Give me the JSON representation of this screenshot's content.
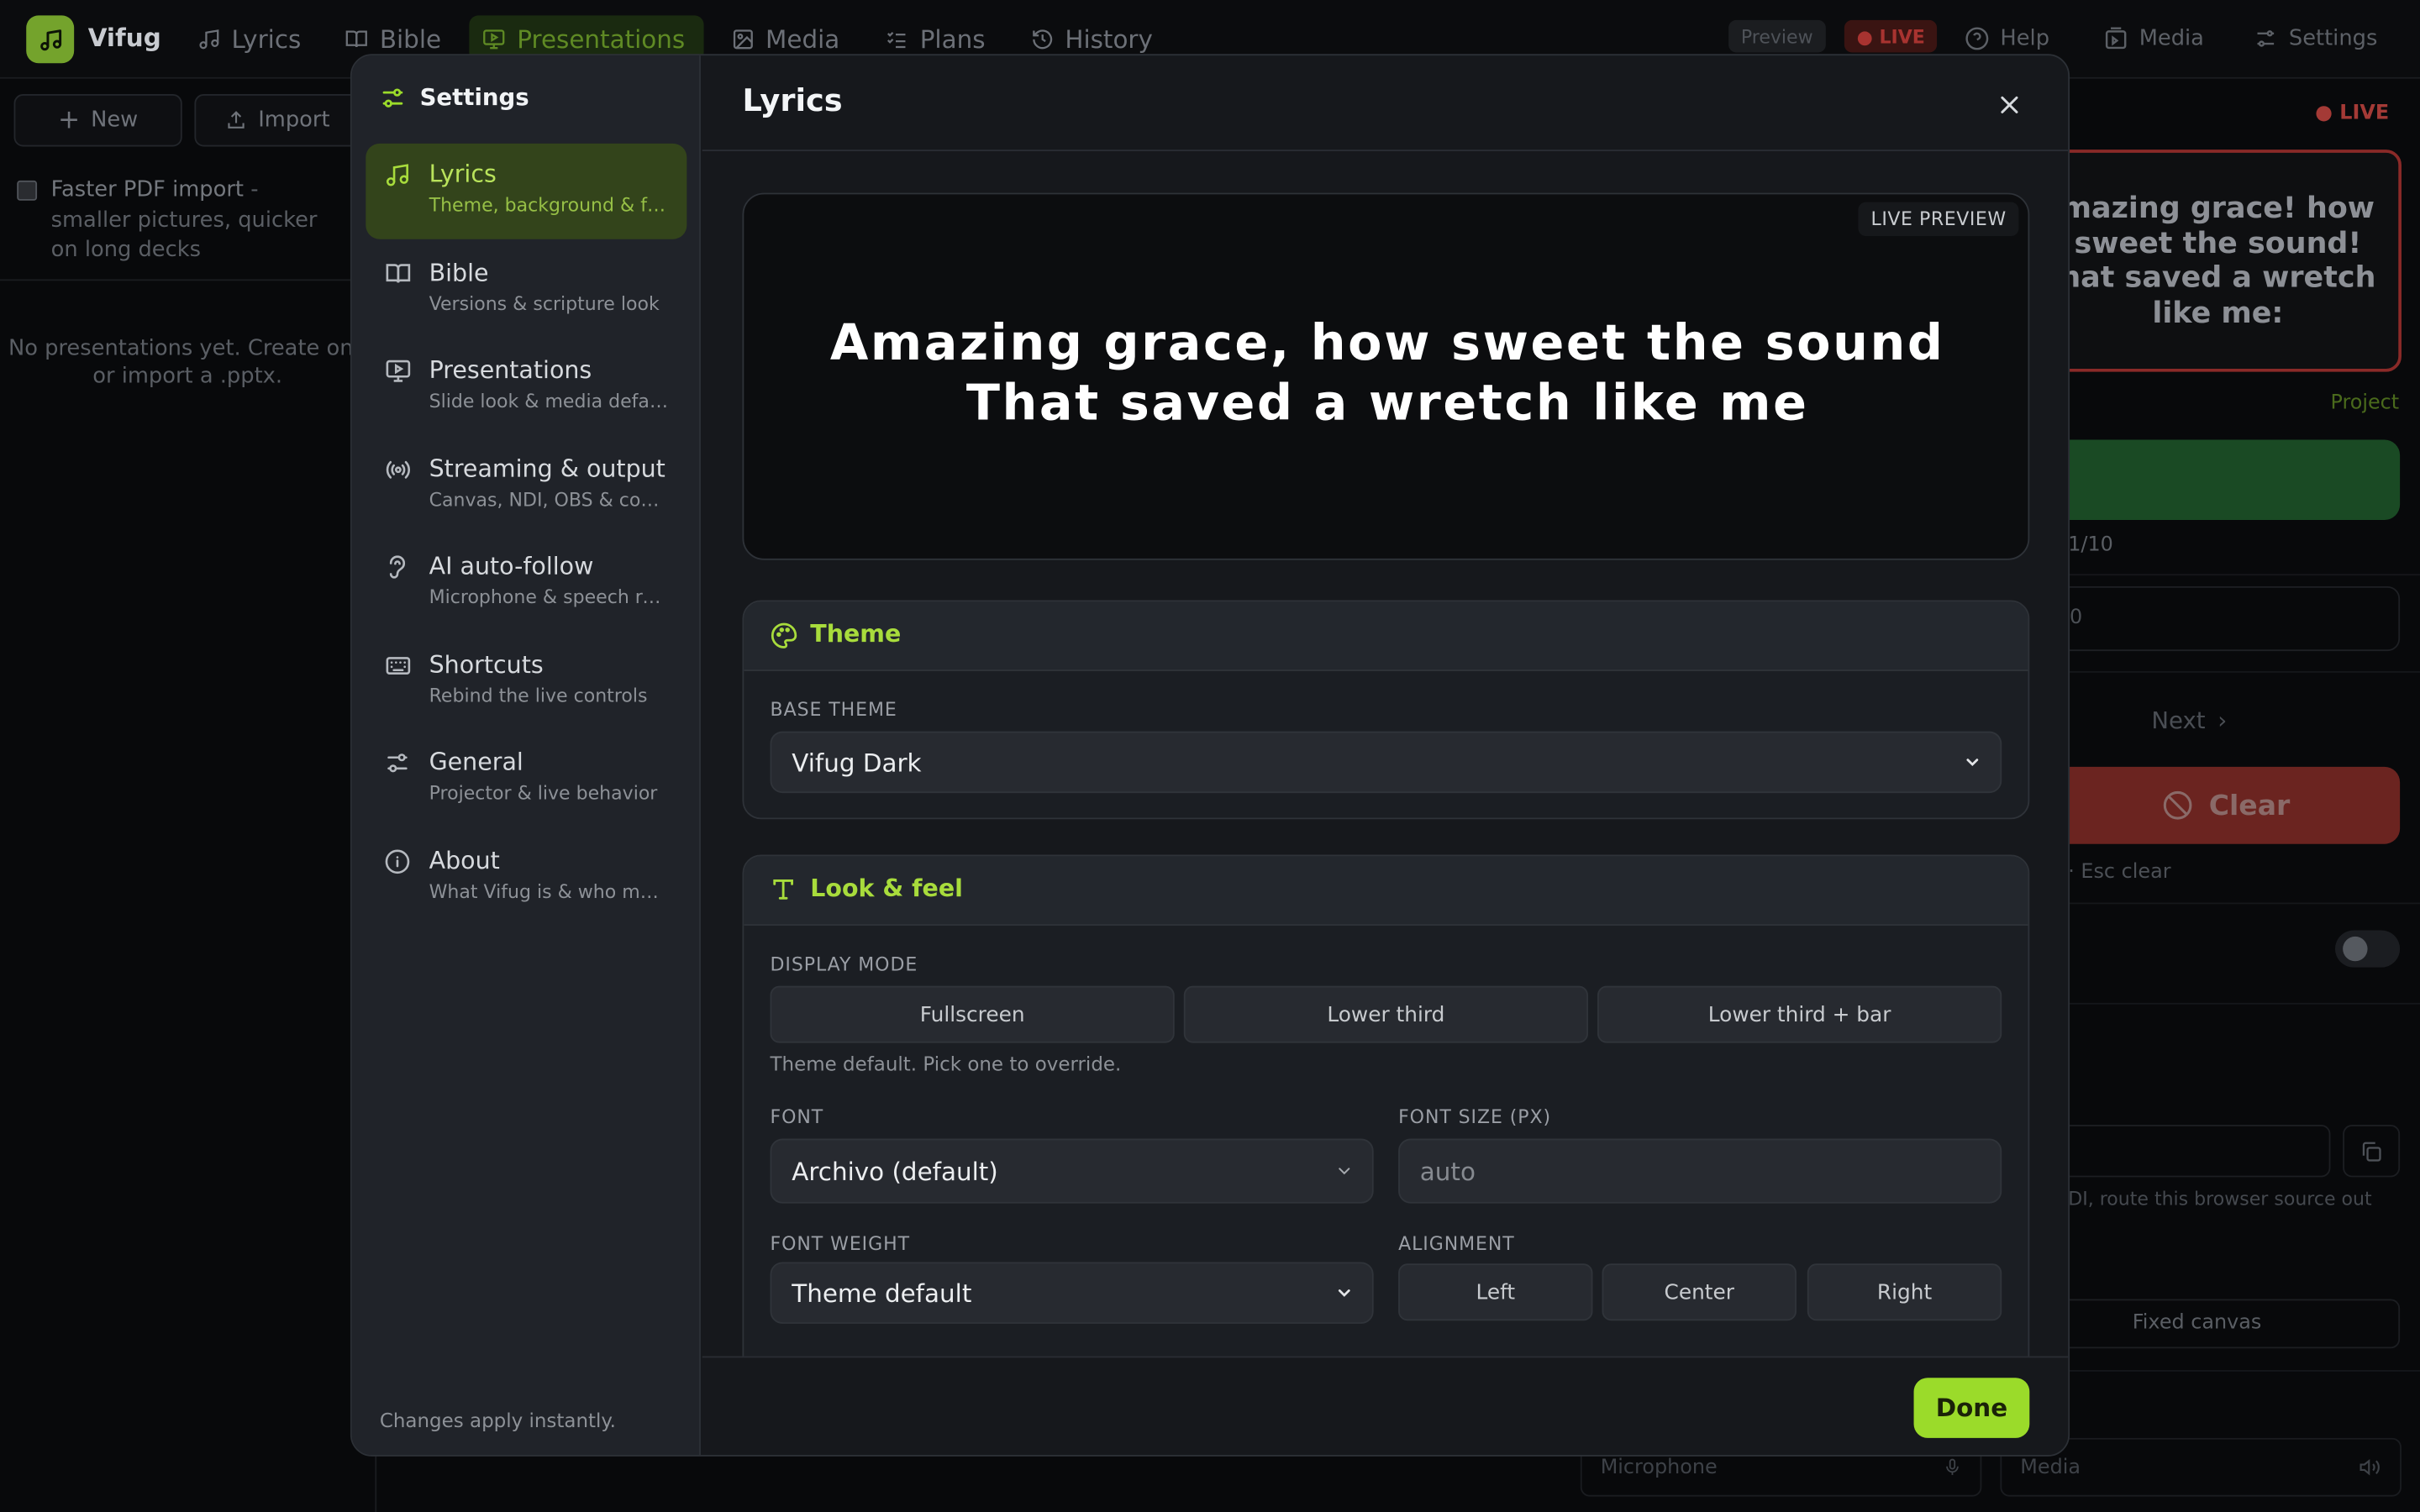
{
  "app": {
    "name": "Vifug",
    "nav": [
      "Lyrics",
      "Bible",
      "Presentations",
      "Media",
      "Plans",
      "History"
    ],
    "preview_pill": "Preview",
    "live_pill": "● LIVE",
    "right_nav": [
      "Help",
      "Media",
      "Settings"
    ]
  },
  "left_panel": {
    "new_label": "New",
    "import_label": "Import",
    "faster_pdf_bold": "Faster PDF import",
    "faster_pdf_rest": " - smaller pictures, quicker on long decks",
    "empty_text": "No presentations yet. Create one or import a .pptx."
  },
  "right_panel": {
    "live_tag": "● LIVE",
    "lyric": "mazing grace! how sweet the sound! hat saved a wretch like me:",
    "project": "Project",
    "counter": "1/10",
    "input_value": "0",
    "next": "Next",
    "clear": "Clear",
    "esc_hint": "· Esc clear",
    "ndi_hint": "DI, route this browser source out",
    "fixed_canvas": "Fixed canvas",
    "microphone": "Microphone",
    "media": "Media"
  },
  "settings": {
    "title": "Settings",
    "footer": "Changes apply instantly.",
    "items": [
      {
        "label": "Lyrics",
        "desc": "Theme, background & font"
      },
      {
        "label": "Bible",
        "desc": "Versions & scripture look"
      },
      {
        "label": "Presentations",
        "desc": "Slide look & media defaults"
      },
      {
        "label": "Streaming & output",
        "desc": "Canvas, NDI, OBS & companion"
      },
      {
        "label": "AI auto-follow",
        "desc": "Microphone & speech recognition"
      },
      {
        "label": "Shortcuts",
        "desc": "Rebind the live controls"
      },
      {
        "label": "General",
        "desc": "Projector & live behavior"
      },
      {
        "label": "About",
        "desc": "What Vifug is & who made it"
      }
    ],
    "active_index": 0
  },
  "panel": {
    "title": "Lyrics",
    "preview_tag": "LIVE PREVIEW",
    "preview_lines": [
      "Amazing grace, how sweet the sound",
      "That saved a wretch like me"
    ],
    "theme": {
      "title": "Theme",
      "base_label": "BASE THEME",
      "base_value": "Vifug Dark"
    },
    "look": {
      "title": "Look & feel",
      "display_label": "DISPLAY MODE",
      "display_modes": [
        "Fullscreen",
        "Lower third",
        "Lower third + bar"
      ],
      "display_hint": "Theme default. Pick one to override.",
      "font_label": "FONT",
      "font_value": "Archivo (default)",
      "font_size_label": "FONT SIZE (PX)",
      "font_size_placeholder": "auto",
      "weight_label": "FONT WEIGHT",
      "weight_value": "Theme default",
      "align_label": "ALIGNMENT",
      "align_options": [
        "Left",
        "Center",
        "Right"
      ]
    },
    "done_label": "Done"
  },
  "colors": {
    "accent": "#9bdb2a",
    "accent_text": "#a8dc3c",
    "live_red": "#d8332e"
  }
}
